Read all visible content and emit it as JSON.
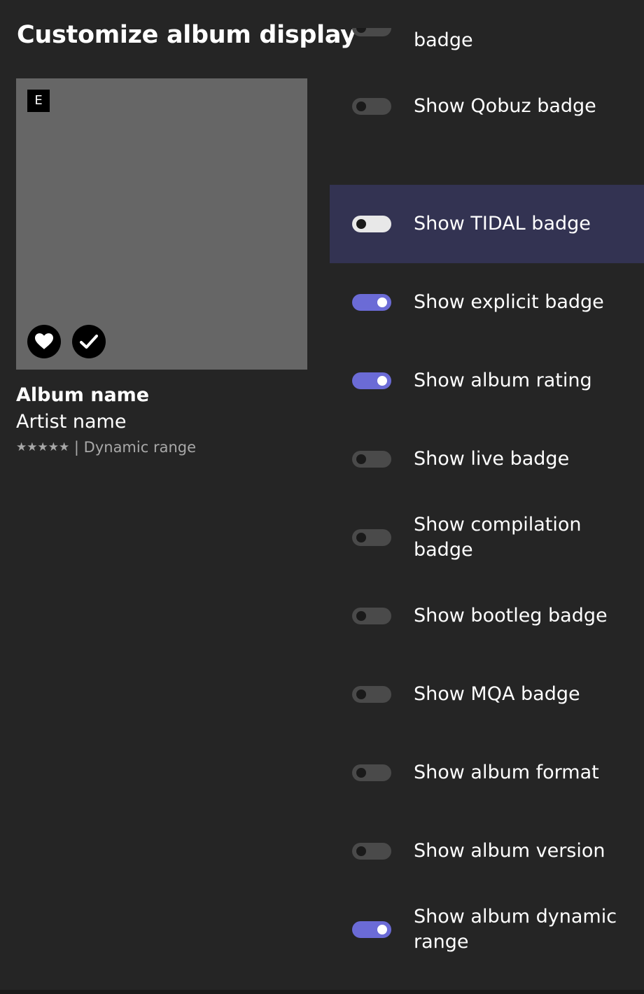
{
  "title": "Customize album display",
  "preview": {
    "explicit_badge": "E",
    "favorite_icon": "heart-icon",
    "in_library_icon": "checkmark-icon",
    "album_name": "Album name",
    "artist_name": "Artist name",
    "rating_stars": "★★★★★",
    "separator": "|",
    "dynamic_range": "Dynamic range"
  },
  "settings": [
    {
      "label": "Show \"In library\" badge",
      "on": false
    },
    {
      "label": "Show Qobuz badge",
      "on": false
    },
    {
      "label": "Show TIDAL badge",
      "on": false,
      "focused": true
    },
    {
      "label": "Show explicit badge",
      "on": true
    },
    {
      "label": "Show album rating",
      "on": true
    },
    {
      "label": "Show live badge",
      "on": false
    },
    {
      "label": "Show compilation badge",
      "on": false
    },
    {
      "label": "Show bootleg badge",
      "on": false
    },
    {
      "label": "Show MQA badge",
      "on": false
    },
    {
      "label": "Show album format",
      "on": false
    },
    {
      "label": "Show album version",
      "on": false
    },
    {
      "label": "Show album dynamic range",
      "on": true
    }
  ],
  "colors": {
    "background": "#252525",
    "focus_highlight": "#333352",
    "toggle_on": "#6b6bd6",
    "toggle_off": "#4a4a4a"
  }
}
